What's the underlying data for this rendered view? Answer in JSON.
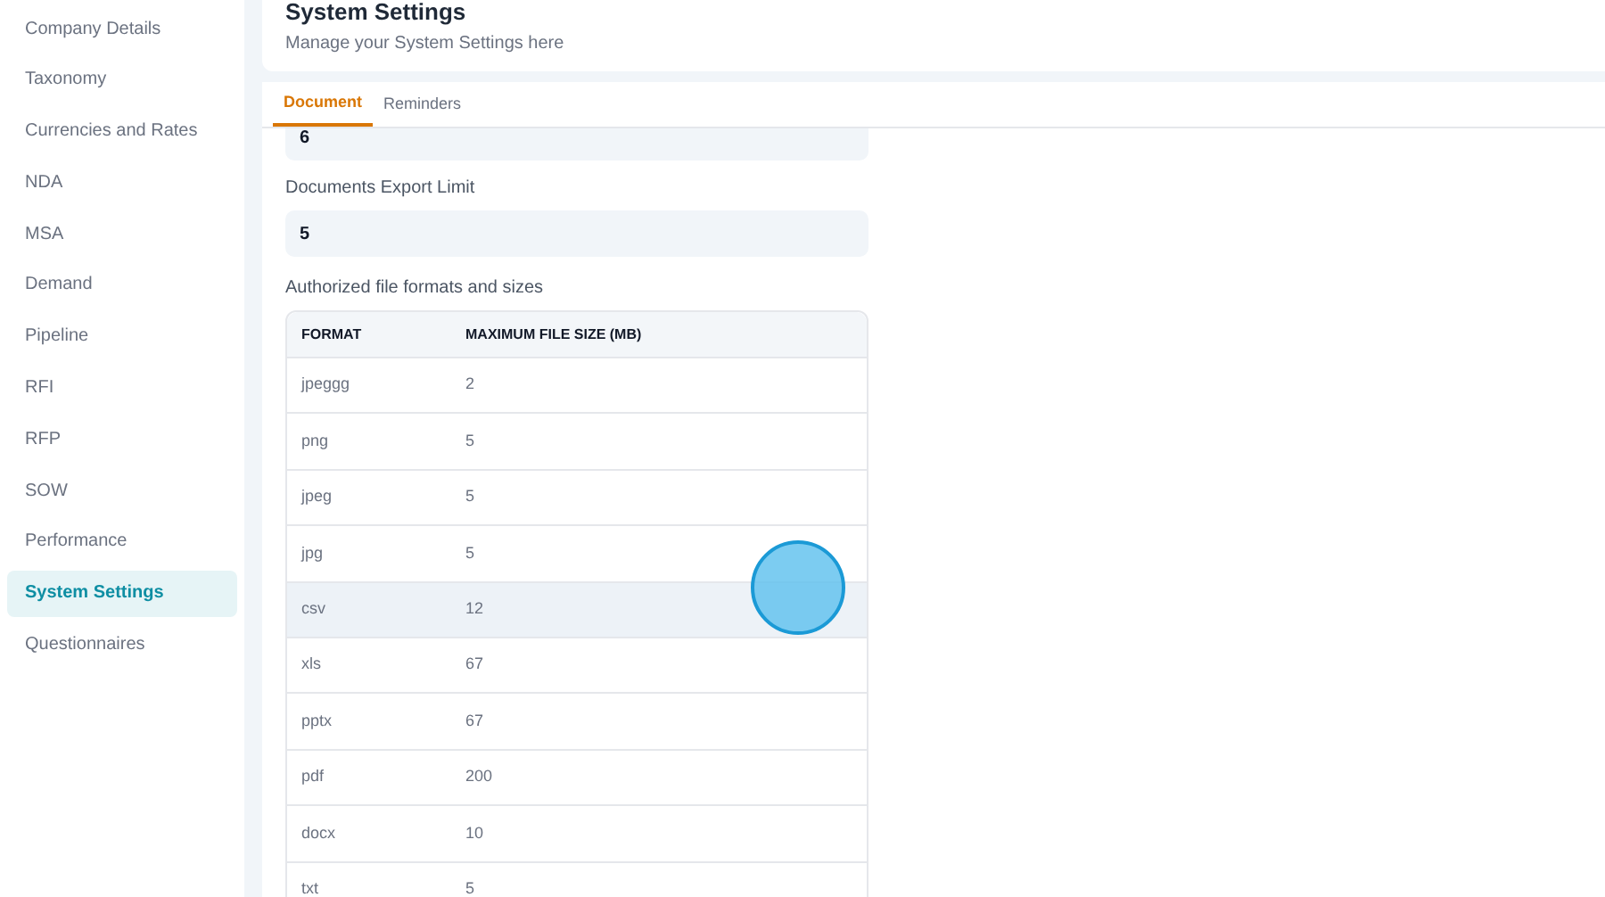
{
  "sidebar": {
    "items": [
      {
        "label": "Company Details",
        "selected": false
      },
      {
        "label": "Taxonomy",
        "selected": false
      },
      {
        "label": "Currencies and Rates",
        "selected": false
      },
      {
        "label": "NDA",
        "selected": false
      },
      {
        "label": "MSA",
        "selected": false
      },
      {
        "label": "Demand",
        "selected": false
      },
      {
        "label": "Pipeline",
        "selected": false
      },
      {
        "label": "RFI",
        "selected": false
      },
      {
        "label": "RFP",
        "selected": false
      },
      {
        "label": "SOW",
        "selected": false
      },
      {
        "label": "Performance",
        "selected": false
      },
      {
        "label": "System Settings",
        "selected": true
      },
      {
        "label": "Questionnaires",
        "selected": false
      }
    ]
  },
  "header": {
    "title": "System Settings",
    "subtitle": "Manage your System Settings here"
  },
  "tabs": [
    {
      "label": "Document",
      "selected": true
    },
    {
      "label": "Reminders",
      "selected": false
    }
  ],
  "fields": [
    {
      "value": "6"
    },
    {
      "label": "Documents Export Limit",
      "value": "5"
    }
  ],
  "table": {
    "title": "Authorized file formats and sizes",
    "columns": [
      "FORMAT",
      "MAXIMUM FILE SIZE (MB)"
    ],
    "rows": [
      {
        "cells": [
          "jpeggg",
          "2"
        ],
        "hovered": false
      },
      {
        "cells": [
          "png",
          "5"
        ],
        "hovered": false
      },
      {
        "cells": [
          "jpeg",
          "5"
        ],
        "hovered": false
      },
      {
        "cells": [
          "jpg",
          "5"
        ],
        "hovered": false
      },
      {
        "cells": [
          "csv",
          "12"
        ],
        "hovered": true
      },
      {
        "cells": [
          "xls",
          "67"
        ],
        "hovered": false
      },
      {
        "cells": [
          "pptx",
          "67"
        ],
        "hovered": false
      },
      {
        "cells": [
          "pdf",
          "200"
        ],
        "hovered": false
      },
      {
        "cells": [
          "docx",
          "10"
        ],
        "hovered": false
      },
      {
        "cells": [
          "txt",
          "5"
        ],
        "hovered": false
      }
    ]
  }
}
